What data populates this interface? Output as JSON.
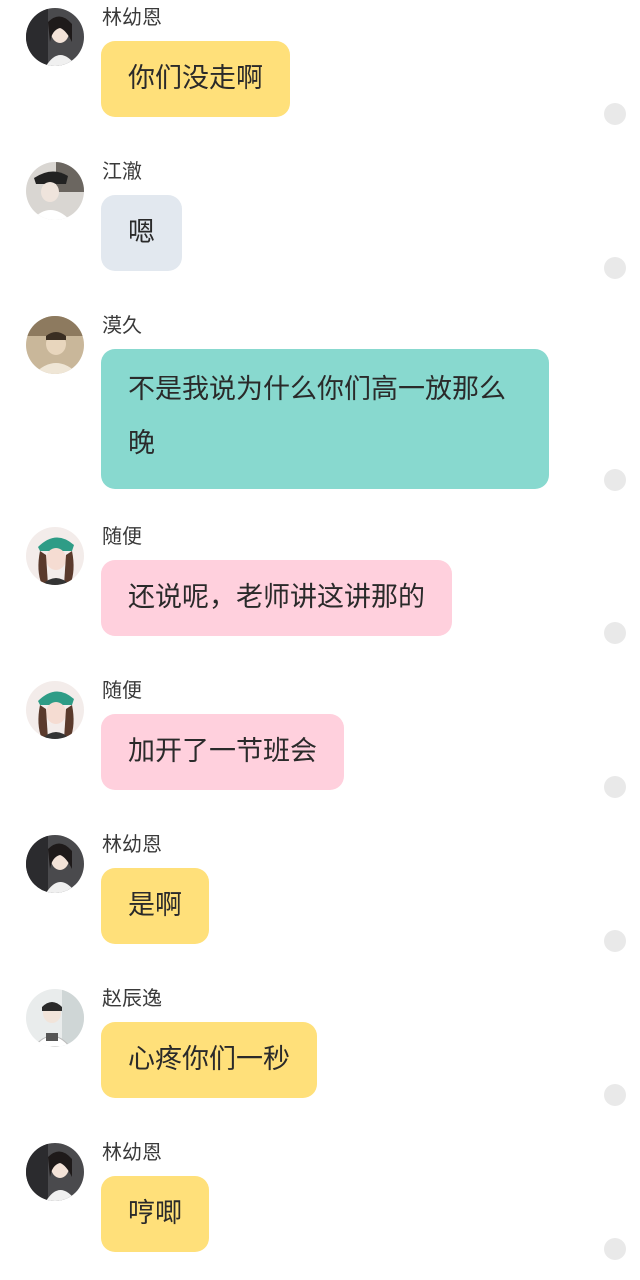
{
  "messages": [
    {
      "sender": "林幼恩",
      "text": "你们没走啊",
      "bubble_color": "#ffe07a",
      "avatar": "avatar-girl-dark-hair"
    },
    {
      "sender": "江澈",
      "text": "嗯",
      "bubble_color": "#e2e8ef",
      "avatar": "avatar-boy-cap"
    },
    {
      "sender": "漠久",
      "text": "不是我说为什么你们高一放那么晚",
      "bubble_color": "#88d9cf",
      "avatar": "avatar-boy-sepia"
    },
    {
      "sender": "随便",
      "text": "还说呢，老师讲这讲那的",
      "bubble_color": "#ffd0dd",
      "avatar": "avatar-girl-green-cap"
    },
    {
      "sender": "随便",
      "text": "加开了一节班会",
      "bubble_color": "#ffd0dd",
      "avatar": "avatar-girl-green-cap"
    },
    {
      "sender": "林幼恩",
      "text": "是啊",
      "bubble_color": "#ffe07a",
      "avatar": "avatar-girl-dark-hair"
    },
    {
      "sender": "赵辰逸",
      "text": "心疼你们一秒",
      "bubble_color": "#ffe07a",
      "avatar": "avatar-boy-light"
    },
    {
      "sender": "林幼恩",
      "text": "哼唧",
      "bubble_color": "#ffe07a",
      "avatar": "avatar-girl-dark-hair"
    }
  ]
}
